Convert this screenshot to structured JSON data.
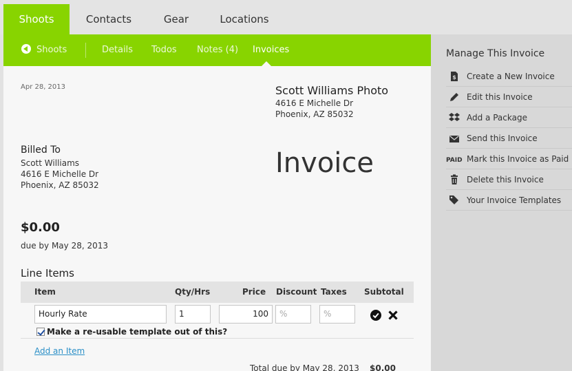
{
  "top_tabs": [
    "Shoots",
    "Contacts",
    "Gear",
    "Locations"
  ],
  "subnav": {
    "back": "Shoots",
    "items": [
      "Details",
      "Todos",
      "Notes (4)",
      "Invoices"
    ]
  },
  "invoice": {
    "date": "Apr 28, 2013",
    "company": "Scott Williams Photo",
    "company_addr1": "4616 E Michelle Dr",
    "company_addr2": "Phoenix, AZ 85032",
    "title": "Invoice",
    "billed_to_label": "Billed To",
    "billed_name": "Scott Williams",
    "billed_addr1": "4616 E Michelle Dr",
    "billed_addr2": "Phoenix, AZ 85032",
    "amount": "$0.00",
    "due": "due by May 28, 2013",
    "line_items_heading": "Line Items",
    "columns": [
      "Item",
      "Qty/Hrs",
      "Price",
      "Discount",
      "Taxes",
      "Subtotal"
    ],
    "row": {
      "item": "Hourly Rate",
      "qty": "1",
      "price": "100",
      "discount_placeholder": "%",
      "taxes_placeholder": "%"
    },
    "template_label": "Make a re-usable template out of this?",
    "add_item": "Add an Item",
    "total_label": "Total due by May 28, 2013",
    "total_value": "$0.00"
  },
  "sidebar": {
    "title": "Manage This Invoice",
    "items": [
      {
        "label": "Create a New Invoice",
        "icon": "new-invoice-icon"
      },
      {
        "label": "Edit this Invoice",
        "icon": "pencil-icon"
      },
      {
        "label": "Add a Package",
        "icon": "dropbox-package-icon"
      },
      {
        "label": "Send this Invoice",
        "icon": "envelope-icon"
      },
      {
        "label": "Mark this Invoice as Paid",
        "icon": "paid-stamp-icon",
        "icon_text": "PAID"
      },
      {
        "label": "Delete this Invoice",
        "icon": "trash-icon"
      },
      {
        "label": "Your Invoice Templates",
        "icon": "tags-icon"
      }
    ]
  },
  "colors": {
    "accent": "#88d400",
    "link": "#2a8fc7",
    "sidebar_bg": "#d8d8d8",
    "main_bg": "#f7f7f7"
  }
}
